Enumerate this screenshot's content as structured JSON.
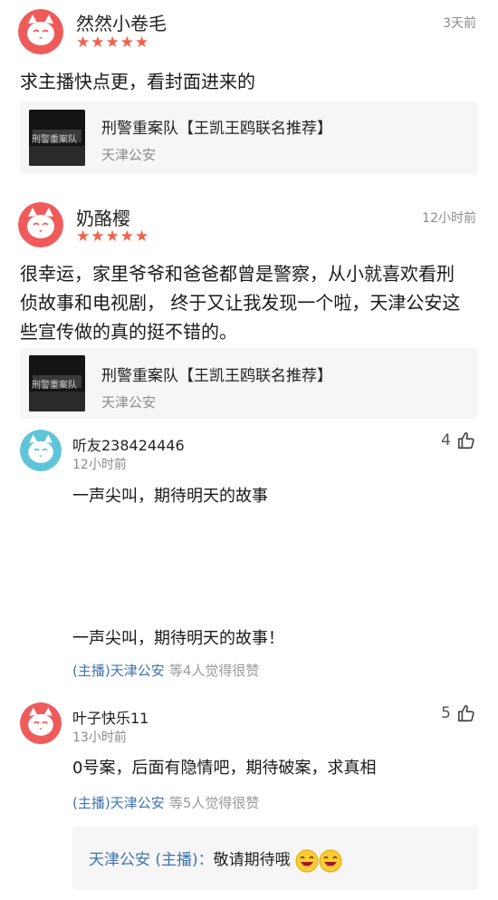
{
  "comments": [
    {
      "user": "然然小卷毛",
      "time": "3天前",
      "stars": "★★★★★",
      "text": "求主播快点更，看封面进来的",
      "card": {
        "title": "刑警重案队【王凯王鸥联名推荐】",
        "subtitle": "天津公安",
        "cover_text": "刑警重案队"
      }
    },
    {
      "user": "奶酪樱",
      "time": "12小时前",
      "stars": "★★★★★",
      "text_lines": [
        "很幸运，家里爷爷和爸爸都曾是警察，从小就喜欢看刑",
        "侦故事和电视剧， 终于又让我发现一个啦，天津公安这",
        "些宣传做的真的挺不错的。"
      ],
      "card": {
        "title": "刑警重案队【王凯王鸥联名推荐】",
        "subtitle": "天津公安",
        "cover_text": "刑警重案队"
      }
    }
  ],
  "replies": [
    {
      "user": "听友238424446",
      "time": "12小时前",
      "likes": "4",
      "text": "一声尖叫，期待明天的故事",
      "text2": "一声尖叫，期待明天的故事！",
      "host_link": "(主播)天津公安",
      "host_note": "等4人觉得很赞"
    },
    {
      "user": "叶子快乐11",
      "time": "13小时前",
      "likes": "5",
      "text": "0号案，后面有隐情吧，期待破案，求真相",
      "host_link": "(主播)天津公安",
      "host_note": "等5人觉得很赞",
      "host_reply": {
        "name": "天津公安 (主播)：",
        "text": "敬请期待哦"
      }
    }
  ],
  "colors": {
    "star": "#f1614c",
    "link": "#3f74b3",
    "avatar_red": "#ef5b5b",
    "avatar_teal": "#5fc4d8"
  },
  "icons": {
    "avatar": "fox-avatar-icon",
    "like": "thumbs-up-icon",
    "emoji": "laughing-emoji-icon"
  }
}
